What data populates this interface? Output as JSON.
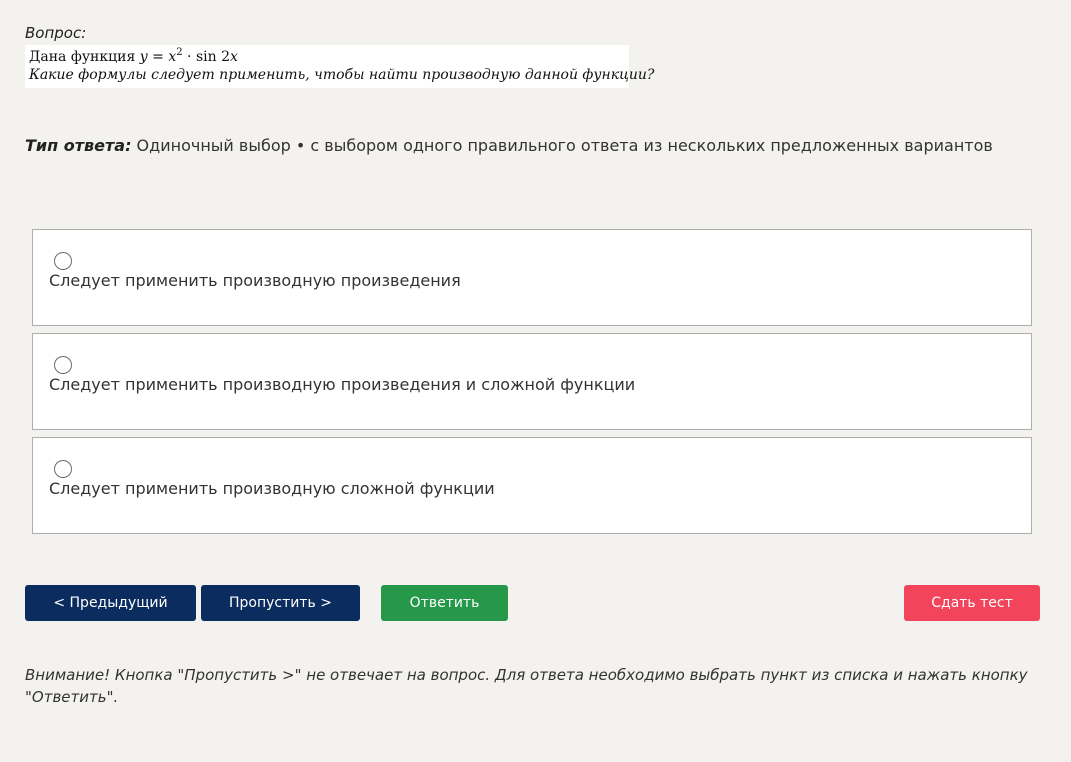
{
  "question": {
    "label": "Вопрос:",
    "line1_prefix": "Дана функция ",
    "formula": {
      "y": "y",
      "eq": " = ",
      "x": "x",
      "exp": "2",
      "rest": " · sin 2",
      "x2": "x"
    },
    "line2": "Какие формулы следует применить, чтобы найти производную данной функции?"
  },
  "answer_type": {
    "label": "Тип ответа:",
    "value": " Одиночный выбор • с выбором одного правильного ответа из нескольких предложенных вариантов"
  },
  "options": [
    {
      "label": "Следует применить производную произведения",
      "selected": false
    },
    {
      "label": "Следует применить производную произведения и сложной функции",
      "selected": false
    },
    {
      "label": "Следует применить производную сложной функции",
      "selected": false
    }
  ],
  "buttons": {
    "prev": "< Предыдущий",
    "skip": "Пропустить >",
    "answer": "Ответить",
    "submit": "Сдать тест"
  },
  "colors": {
    "nav_button": "#0a2c5e",
    "answer_button": "#25984a",
    "submit_button": "#f2445a",
    "background": "#f3f2ef"
  },
  "warning": "Внимание! Кнопка \"Пропустить >\" не отвечает на вопрос. Для ответа необходимо выбрать пункт из списка и нажать кнопку \"Ответить\"."
}
